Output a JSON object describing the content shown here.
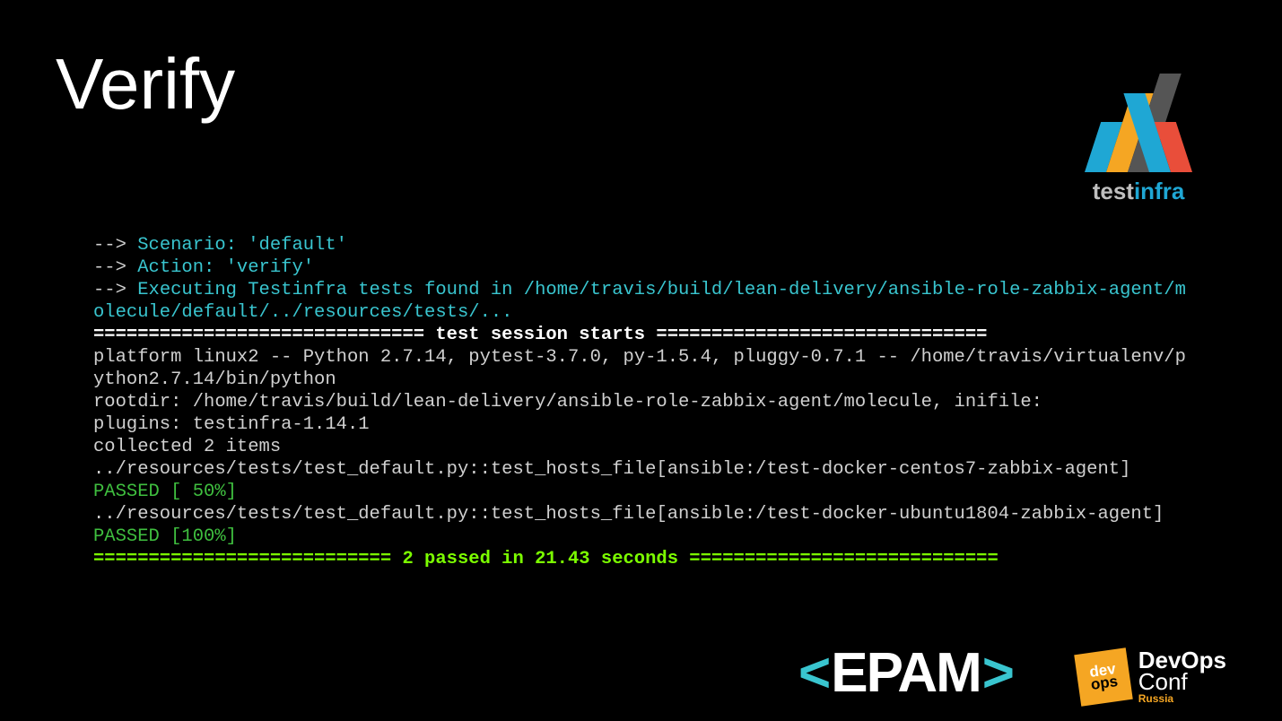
{
  "title": "Verify",
  "logo_testinfra": {
    "part1": "test",
    "part2": "infra"
  },
  "logo_epam": {
    "open": "<",
    "word": "epam",
    "close": ">"
  },
  "logo_devopsconf": {
    "badge_l1": "dev",
    "badge_l2": "ops",
    "row1": "DevOps",
    "row2": "Conf",
    "row3": "Russia"
  },
  "term": {
    "l01a": "--> ",
    "l01b": "Scenario: 'default'",
    "l02a": "--> ",
    "l02b": "Action: 'verify'",
    "l03a": "--> ",
    "l03b": "Executing Testinfra tests found in /home/travis/build/lean-delivery/ansible-role-zabbix-agent/molecule/default/../resources/tests/...",
    "l04": "============================== test session starts ==============================",
    "l05": "platform linux2 -- Python 2.7.14, pytest-3.7.0, py-1.5.4, pluggy-0.7.1 -- /home/travis/virtualenv/python2.7.14/bin/python",
    "l06": "rootdir: /home/travis/build/lean-delivery/ansible-role-zabbix-agent/molecule, inifile:",
    "l07": "plugins: testinfra-1.14.1",
    "l08": "collected 2 items",
    "l09": "../resources/tests/test_default.py::test_hosts_file[ansible:/test-docker-centos7-zabbix-agent]",
    "l10": "PASSED [ 50%]",
    "l11": "../resources/tests/test_default.py::test_hosts_file[ansible:/test-docker-ubuntu1804-zabbix-agent]",
    "l12": "PASSED [100%]",
    "l13": "=========================== 2 passed in 21.43 seconds ============================"
  }
}
